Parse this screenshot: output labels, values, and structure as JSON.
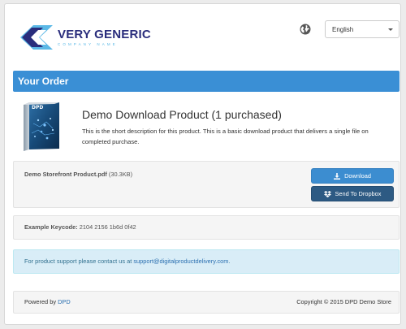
{
  "header": {
    "logo_main": "VERY GENERIC",
    "logo_sub": "COMPANY NAME",
    "language_selected": "English"
  },
  "order": {
    "heading": "Your Order"
  },
  "product": {
    "box_label": "DPD",
    "title": "Demo Download Product (1 purchased)",
    "description": "This is the short description for this product. This is a basic download product that delivers a single file on completed purchase."
  },
  "file": {
    "name": "Demo Storefront Product.pdf",
    "size": "(30.3KB)",
    "download_label": "Download",
    "dropbox_label": "Send To Dropbox"
  },
  "keycode": {
    "label": "Example Keycode:",
    "value": "2104 2156 1b6d 0f42"
  },
  "support": {
    "text": "For product support please contact us at",
    "email": "support@digitalproductdelivery.com",
    "end": "."
  },
  "footer": {
    "powered_by": "Powered by",
    "powered_link": "DPD",
    "copyright": "Copyright © 2015 DPD Demo Store"
  },
  "colors": {
    "accent": "#3a8fd5",
    "dropbox_button": "#2d5a83",
    "support_bg": "#d9edf7"
  }
}
